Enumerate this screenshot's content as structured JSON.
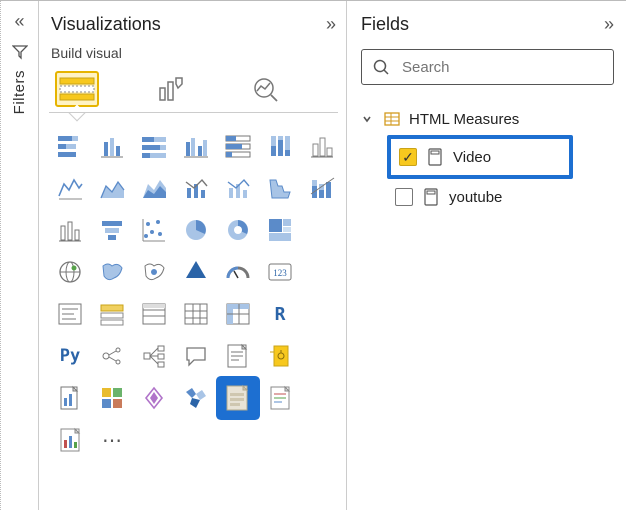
{
  "filters": {
    "label": "Filters"
  },
  "viz": {
    "title": "Visualizations",
    "subtitle": "Build visual",
    "tabs": [
      "build",
      "format",
      "analytics"
    ],
    "grid": [
      [
        "stacked-bar",
        "clustered-bar",
        "stacked-100-bar",
        "clustered-column",
        "stacked-column",
        "stacked-100-column",
        "line"
      ],
      [
        "area",
        "stacked-area",
        "line-clustered-column",
        "line-stacked-column",
        "ribbon",
        "waterfall",
        "funnel-alt"
      ],
      [
        "scatter",
        "funnel",
        "scatter-dot",
        "pie",
        "donut",
        "treemap",
        ""
      ],
      [
        "map",
        "filled-map",
        "azure-map",
        "arcgis",
        "gauge",
        "card",
        "multi-row-card"
      ],
      [
        "kpi",
        "slicer",
        "table",
        "matrix",
        "matrix-pivot",
        "r-visual",
        ""
      ],
      [
        "python-visual",
        "key-influencers",
        "decomposition-tree",
        "qa",
        "smart-narrative",
        "paginated-report",
        ""
      ],
      [
        "power-apps",
        "power-automate",
        "get-more",
        "custom-a",
        "custom-html",
        "custom-b",
        ""
      ],
      [
        "custom-c",
        "more",
        "",
        "",
        "",
        "",
        ""
      ]
    ],
    "selected": "custom-html",
    "r_label": "R",
    "py_label": "Py",
    "more_label": "⋯"
  },
  "fields": {
    "title": "Fields",
    "search_placeholder": "Search",
    "table": {
      "name": "HTML Measures",
      "items": [
        {
          "name": "Video",
          "checked": true,
          "highlighted": true
        },
        {
          "name": "youtube",
          "checked": false,
          "highlighted": false
        }
      ]
    }
  }
}
